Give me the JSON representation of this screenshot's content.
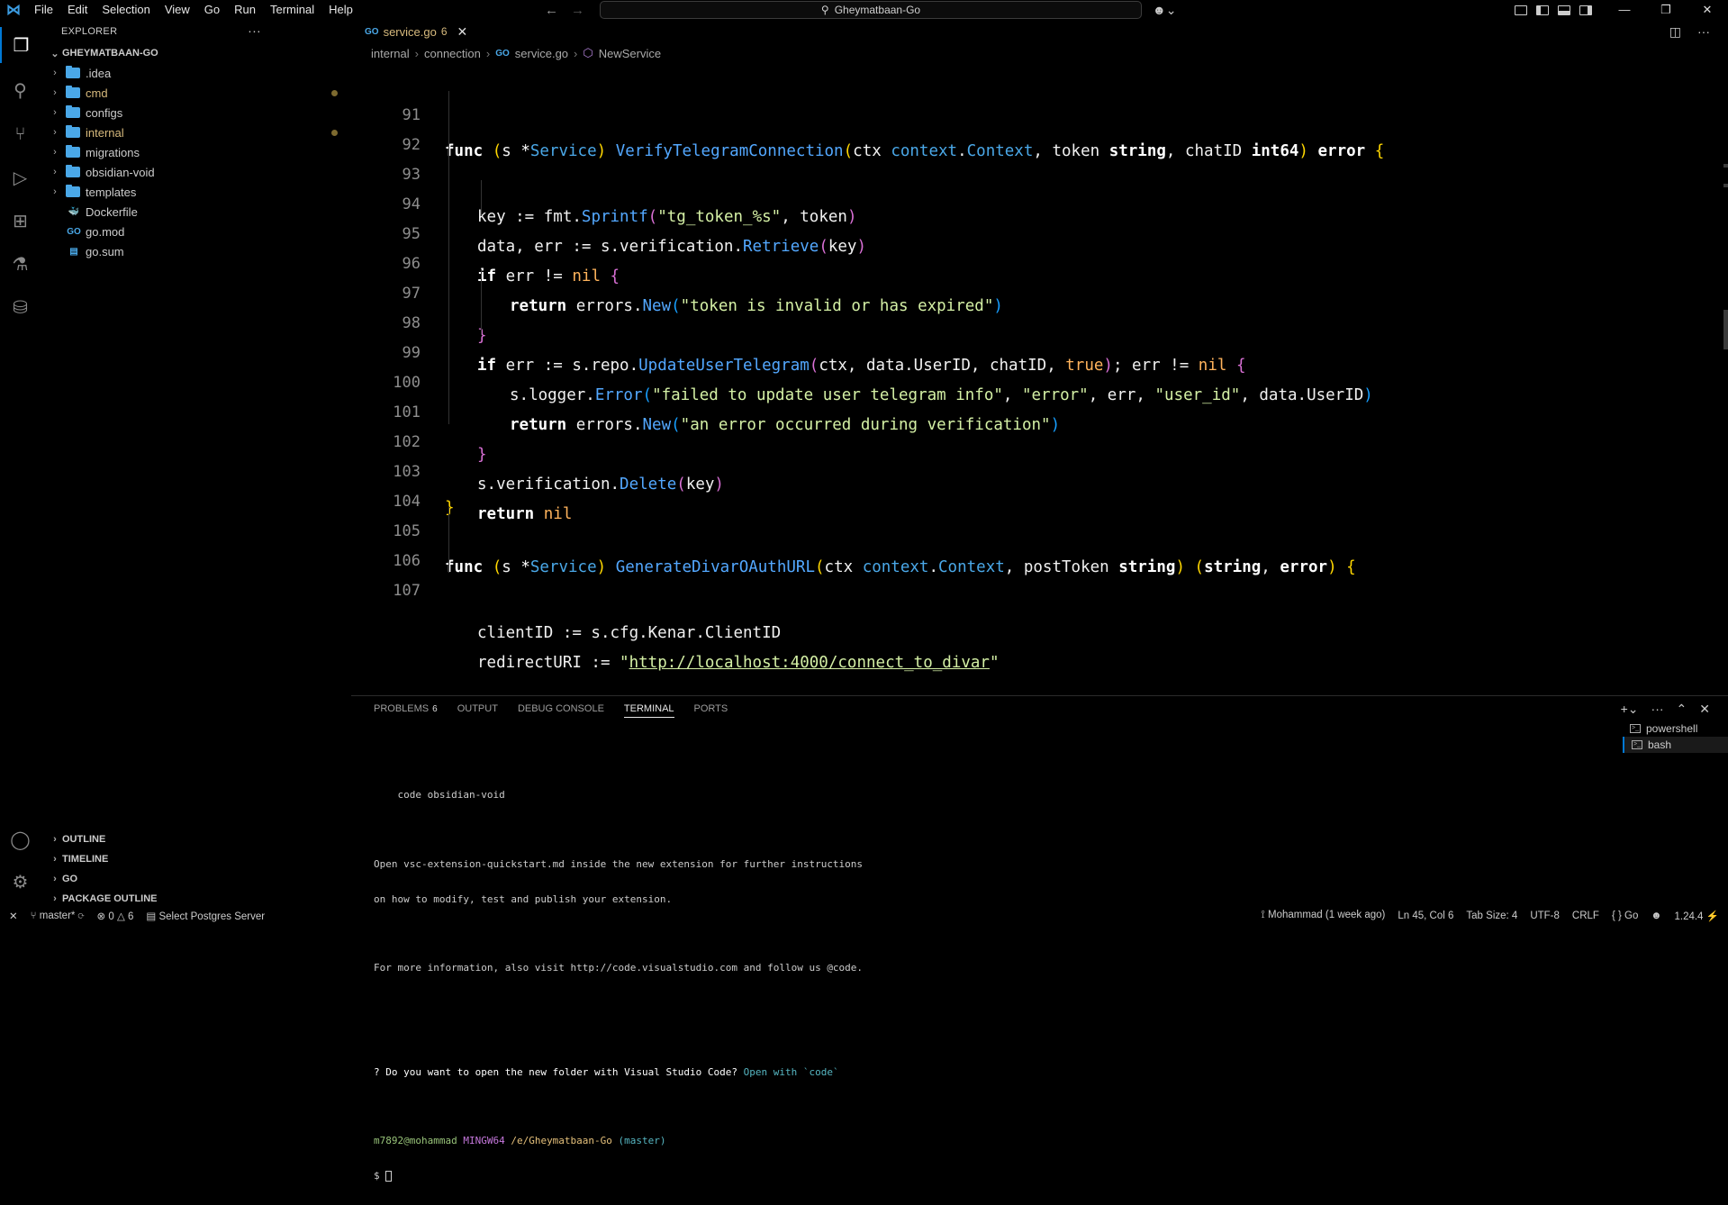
{
  "titlebar": {
    "menus": [
      "File",
      "Edit",
      "Selection",
      "View",
      "Go",
      "Run",
      "Terminal",
      "Help"
    ],
    "search_text": "Gheymatbaan-Go"
  },
  "explorer": {
    "header": "EXPLORER",
    "root": "GHEYMATBAAN-GO",
    "items": [
      {
        "label": ".idea",
        "type": "folder"
      },
      {
        "label": "cmd",
        "type": "folder",
        "modified": true
      },
      {
        "label": "configs",
        "type": "folder"
      },
      {
        "label": "internal",
        "type": "folder",
        "modified": true
      },
      {
        "label": "migrations",
        "type": "folder"
      },
      {
        "label": "obsidian-void",
        "type": "folder"
      },
      {
        "label": "templates",
        "type": "folder"
      },
      {
        "label": "Dockerfile",
        "type": "docker-file"
      },
      {
        "label": "go.mod",
        "type": "go-file"
      },
      {
        "label": "go.sum",
        "type": "sum-file"
      }
    ],
    "bottom_sections": [
      "OUTLINE",
      "TIMELINE",
      "GO",
      "PACKAGE OUTLINE"
    ]
  },
  "editor": {
    "tab": {
      "name": "service.go",
      "problems": "6"
    },
    "breadcrumb": [
      "internal",
      "connection",
      "service.go",
      "NewService"
    ],
    "line_numbers": [
      "91",
      "92",
      "93",
      "94",
      "95",
      "96",
      "97",
      "98",
      "99",
      "100",
      "101",
      "102",
      "103",
      "104",
      "105",
      "106",
      "107"
    ]
  },
  "panel": {
    "tabs": [
      "PROBLEMS",
      "OUTPUT",
      "DEBUG CONSOLE",
      "TERMINAL",
      "PORTS"
    ],
    "problems_count": "6",
    "active_tab": "TERMINAL",
    "terminal_lines": [
      "",
      "    code obsidian-void",
      "",
      "Open vsc-extension-quickstart.md inside the new extension for further instructions",
      "on how to modify, test and publish your extension.",
      "",
      "For more information, also visit http://code.visualstudio.com and follow us @code.",
      "",
      ""
    ],
    "prompt_question": "? Do you want to open the new folder with Visual Studio Code?",
    "prompt_answer": "Open with `code`",
    "ps1": {
      "user": "m7892@mohammad",
      "shell": "MINGW64",
      "path": "/e/Gheymatbaan-Go",
      "branch": "(master)"
    },
    "shell_prompt": "$",
    "terminals": [
      "powershell",
      "bash"
    ]
  },
  "statusbar": {
    "branch": "master*",
    "errors": "0",
    "warnings": "6",
    "postgres": "Select Postgres Server",
    "blame": "Mohammad (1 week ago)",
    "position": "Ln 45, Col 6",
    "tab_size": "Tab Size: 4",
    "encoding": "UTF-8",
    "eol": "CRLF",
    "language": "Go",
    "go_version": "1.24.4"
  },
  "colors": {
    "accent": "#0078d4",
    "folder": "#4aa8e8",
    "modified": "#d7ba7d"
  }
}
